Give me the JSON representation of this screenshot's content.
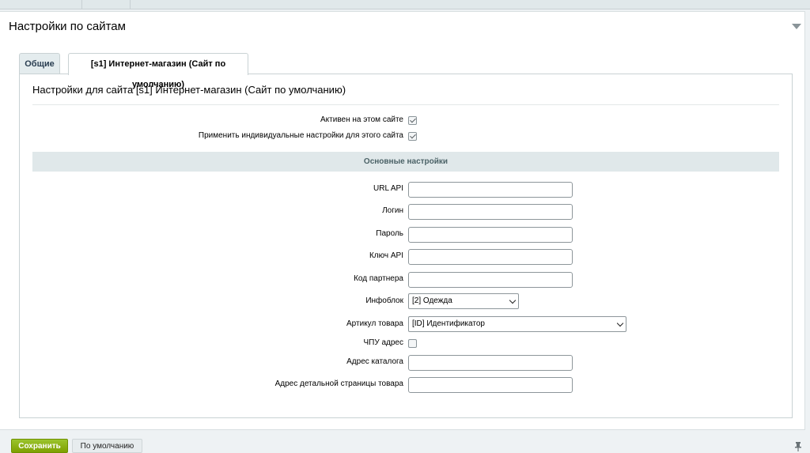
{
  "panel": {
    "title": "Настройки по сайтам"
  },
  "tabs": [
    {
      "label": "Общие",
      "active": false
    },
    {
      "label": "[s1] Интернет-магазин (Сайт по умолчанию)",
      "active": true
    }
  ],
  "site_settings": {
    "title": "Настройки для сайта [s1] Интернет-магазин (Сайт по умолчанию)",
    "active_label": "Активен на этом сайте",
    "active_checked": true,
    "individual_label": "Применить индивидуальные настройки для этого сайта",
    "individual_checked": true
  },
  "group": {
    "title": "Основные настройки"
  },
  "fields": {
    "url_api": {
      "label": "URL API",
      "value": ""
    },
    "login": {
      "label": "Логин",
      "value": ""
    },
    "password": {
      "label": "Пароль",
      "value": ""
    },
    "api_key": {
      "label": "Ключ API",
      "value": ""
    },
    "partner_code": {
      "label": "Код партнера",
      "value": ""
    },
    "iblock": {
      "label": "Инфоблок",
      "selected": "[2] Одежда"
    },
    "article": {
      "label": "Артикул товара",
      "selected": "[ID] Идентификатор"
    },
    "sef": {
      "label": "ЧПУ адрес",
      "checked": false
    },
    "catalog_url": {
      "label": "Адрес каталога",
      "value": ""
    },
    "detail_url": {
      "label": "Адрес детальной страницы товара",
      "value": ""
    }
  },
  "footer": {
    "save_label": "Сохранить",
    "default_label": "По умолчанию"
  }
}
